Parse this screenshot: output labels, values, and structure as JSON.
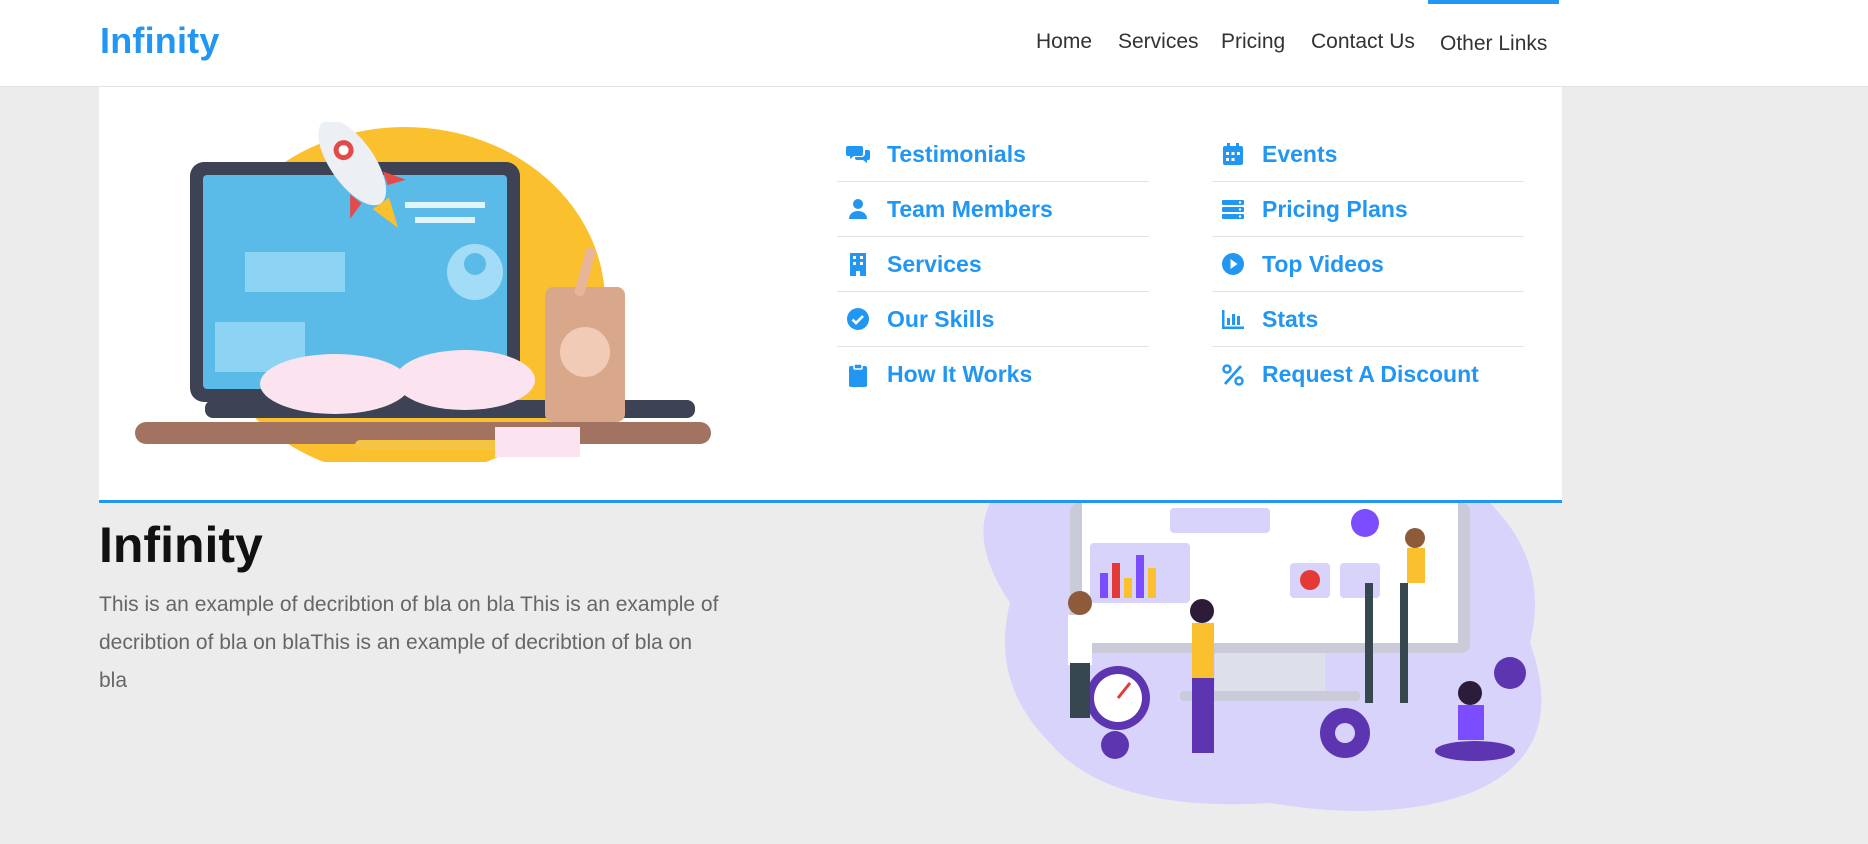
{
  "brand": {
    "name": "Infinity",
    "color": "#2196f3"
  },
  "nav": {
    "items": [
      {
        "label": "Home"
      },
      {
        "label": "Services"
      },
      {
        "label": "Pricing"
      },
      {
        "label": "Contact Us"
      },
      {
        "label": "Other Links",
        "active": true
      }
    ]
  },
  "mega_menu": {
    "columns": [
      [
        {
          "label": "Testimonials",
          "icon": "comments-icon"
        },
        {
          "label": "Team Members",
          "icon": "user-icon"
        },
        {
          "label": "Services",
          "icon": "building-icon"
        },
        {
          "label": "Our Skills",
          "icon": "check-circle-icon"
        },
        {
          "label": "How It Works",
          "icon": "clipboard-icon"
        }
      ],
      [
        {
          "label": "Events",
          "icon": "calendar-icon"
        },
        {
          "label": "Pricing Plans",
          "icon": "server-icon"
        },
        {
          "label": "Top Videos",
          "icon": "play-circle-icon"
        },
        {
          "label": "Stats",
          "icon": "bar-chart-icon"
        },
        {
          "label": "Request A Discount",
          "icon": "percent-icon"
        }
      ]
    ]
  },
  "hero": {
    "title": "Infinity",
    "description": "This is an example of decribtion of bla on bla This is an example of decribtion of bla on blaThis is an example of decribtion of bla on bla"
  }
}
